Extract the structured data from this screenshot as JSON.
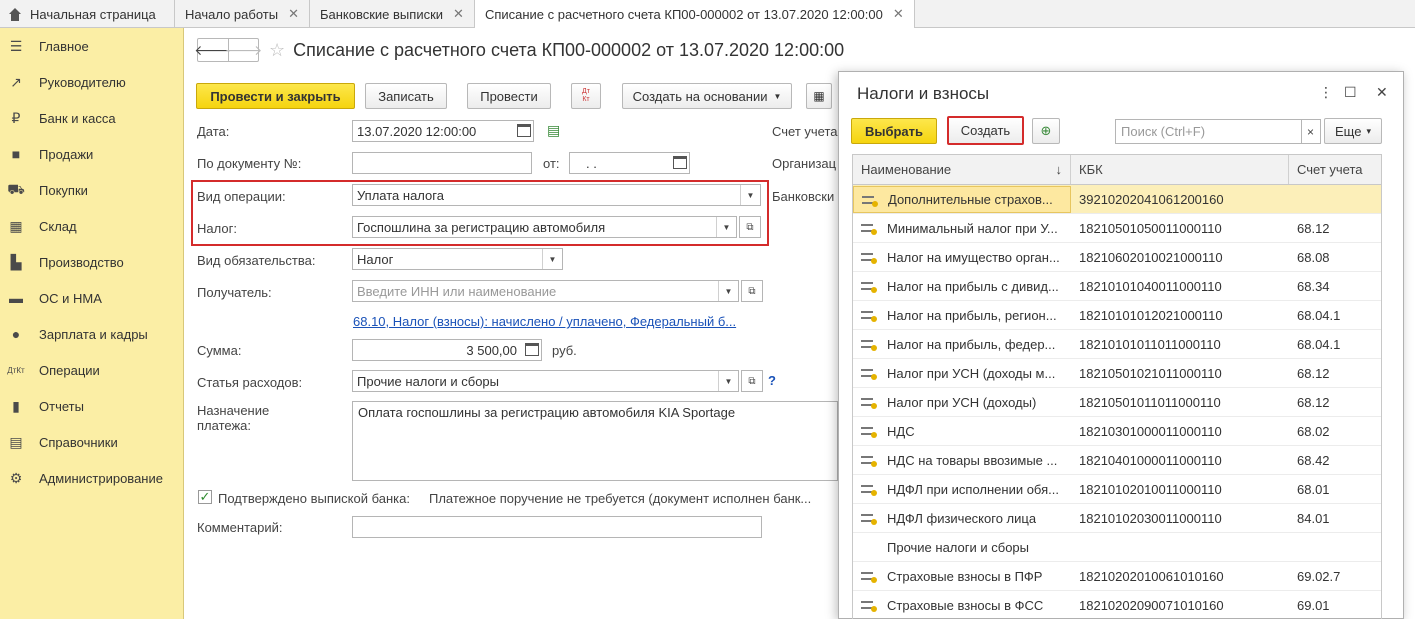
{
  "tabs": [
    {
      "label": "Начальная страница",
      "closable": false
    },
    {
      "label": "Начало работы",
      "closable": true
    },
    {
      "label": "Банковские выписки",
      "closable": true
    },
    {
      "label": "Списание с расчетного счета КП00-000002 от 13.07.2020 12:00:00",
      "closable": true
    }
  ],
  "sidebar": {
    "items": [
      {
        "label": "Главное",
        "icon": "menu-icon"
      },
      {
        "label": "Руководителю",
        "icon": "trend-icon"
      },
      {
        "label": "Банк и касса",
        "icon": "ruble-icon"
      },
      {
        "label": "Продажи",
        "icon": "bag-icon"
      },
      {
        "label": "Покупки",
        "icon": "cart-icon"
      },
      {
        "label": "Склад",
        "icon": "grid-icon"
      },
      {
        "label": "Производство",
        "icon": "factory-icon"
      },
      {
        "label": "ОС и НМА",
        "icon": "truck-icon"
      },
      {
        "label": "Зарплата и кадры",
        "icon": "person-icon"
      },
      {
        "label": "Операции",
        "icon": "dt-kt-icon"
      },
      {
        "label": "Отчеты",
        "icon": "bar-chart-icon"
      },
      {
        "label": "Справочники",
        "icon": "book-icon"
      },
      {
        "label": "Администрирование",
        "icon": "gear-icon"
      }
    ]
  },
  "form": {
    "title": "Списание с расчетного счета КП00-000002 от 13.07.2020 12:00:00",
    "toolbar": {
      "post_close": "Провести и закрыть",
      "save": "Записать",
      "post": "Провести",
      "dtkt_top": "Дт",
      "dtkt_bottom": "Кт",
      "create_based": "Создать на основании"
    },
    "date_label": "Дата:",
    "date_value": "13.07.2020 12:00:00",
    "docnum_label": "По документу №:",
    "from_label": "от:",
    "from_value": ". .",
    "op_type_label": "Вид операции:",
    "op_type_value": "Уплата налога",
    "tax_label": "Налог:",
    "tax_value": "Госпошлина за регистрацию автомобиля",
    "obligation_label": "Вид обязательства:",
    "obligation_value": "Налог",
    "recipient_label": "Получатель:",
    "recipient_placeholder": "Введите ИНН или наименование",
    "account_link": "68.10, Налог (взносы): начислено / уплачено, Федеральный б...",
    "sum_label": "Сумма:",
    "sum_value": "3 500,00",
    "currency": "руб.",
    "expense_label": "Статья расходов:",
    "expense_value": "Прочие налоги и сборы",
    "help": "?",
    "purpose_label_1": "Назначение",
    "purpose_label_2": "платежа:",
    "purpose_value": "Оплата госпошлины за регистрацию автомобиля KIA Sportage",
    "confirmed_label": "Подтверждено выпиской банка:",
    "payment_note": "Платежное поручение не требуется (документ исполнен банк...",
    "comment_label": "Комментарий:",
    "right_labels": [
      "Счет учета",
      "Организац",
      "Банковски"
    ]
  },
  "popup": {
    "title": "Налоги и взносы",
    "select": "Выбрать",
    "create": "Создать",
    "search_placeholder": "Поиск (Ctrl+F)",
    "clear": "×",
    "more": "Еще",
    "more_arrow": "▾",
    "menu_dots": "⋮",
    "maximize": "☐",
    "close": "✕",
    "columns": {
      "name": "Наименование",
      "sort": "↓",
      "kbk": "КБК",
      "account": "Счет учета"
    },
    "rows": [
      {
        "name": "Дополнительные страхов...",
        "kbk": "39210202041061200160",
        "account": "",
        "selected": true
      },
      {
        "name": "Минимальный налог при У...",
        "kbk": "18210501050011000110",
        "account": "68.12"
      },
      {
        "name": "Налог на имущество орган...",
        "kbk": "18210602010021000110",
        "account": "68.08"
      },
      {
        "name": "Налог на прибыль с дивид...",
        "kbk": "18210101040011000110",
        "account": "68.34"
      },
      {
        "name": "Налог на прибыль, регион...",
        "kbk": "18210101012021000110",
        "account": "68.04.1"
      },
      {
        "name": "Налог на прибыль, федер...",
        "kbk": "18210101011011000110",
        "account": "68.04.1"
      },
      {
        "name": "Налог при УСН (доходы м...",
        "kbk": "18210501021011000110",
        "account": "68.12"
      },
      {
        "name": "Налог при УСН (доходы)",
        "kbk": "18210501011011000110",
        "account": "68.12"
      },
      {
        "name": "НДС",
        "kbk": "18210301000011000110",
        "account": "68.02"
      },
      {
        "name": "НДС на товары ввозимые ...",
        "kbk": "18210401000011000110",
        "account": "68.42"
      },
      {
        "name": "НДФЛ при исполнении обя...",
        "kbk": "18210102010011000110",
        "account": "68.01"
      },
      {
        "name": "НДФЛ физического лица",
        "kbk": "18210102030011000110",
        "account": "84.01"
      },
      {
        "name": "Прочие налоги и сборы",
        "kbk": "",
        "account": "",
        "noicon": true
      },
      {
        "name": "Страховые взносы в ПФР",
        "kbk": "18210202010061010160",
        "account": "69.02.7"
      },
      {
        "name": "Страховые взносы в ФСС",
        "kbk": "18210202090071010160",
        "account": "69.01"
      }
    ]
  }
}
